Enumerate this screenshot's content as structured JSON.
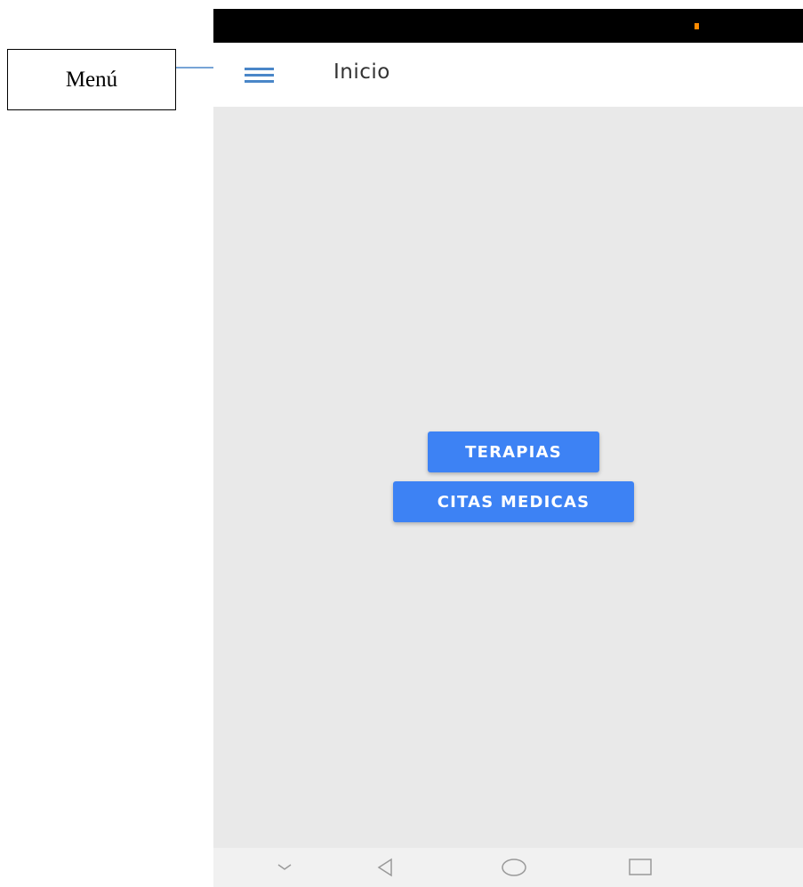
{
  "annotation": {
    "label": "Menú"
  },
  "app_bar": {
    "title": "Inicio",
    "menu_icon": "hamburger-menu-icon"
  },
  "main": {
    "buttons": [
      {
        "label": "TERAPIAS"
      },
      {
        "label": "CITAS MEDICAS"
      }
    ]
  },
  "nav_bar": {
    "items": [
      {
        "icon": "chevron-down-icon"
      },
      {
        "icon": "back-triangle-icon"
      },
      {
        "icon": "home-circle-icon"
      },
      {
        "icon": "recents-square-icon"
      }
    ]
  },
  "colors": {
    "accent": "#3d82f4",
    "background": "#e9e9e9",
    "status_bar": "#000000",
    "annotation_line": "#4a86c8",
    "status_indicator": "#ff8a00"
  }
}
